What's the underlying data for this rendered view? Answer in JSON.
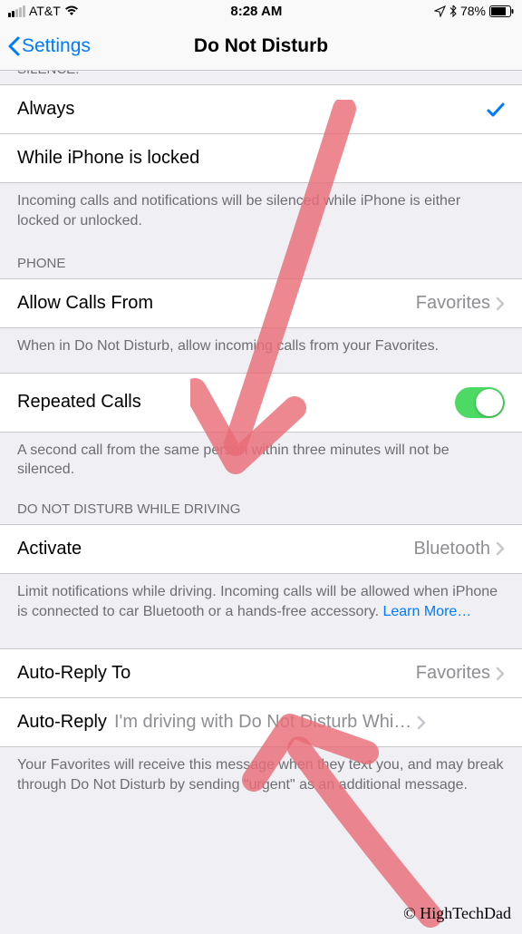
{
  "status_bar": {
    "carrier": "AT&T",
    "time": "8:28 AM",
    "battery_percent": "78%"
  },
  "nav": {
    "back_label": "Settings",
    "title": "Do Not Disturb"
  },
  "silence": {
    "header": "SILENCE:",
    "always_label": "Always",
    "locked_label": "While iPhone is locked",
    "footer": "Incoming calls and notifications will be silenced while iPhone is either locked or unlocked."
  },
  "phone": {
    "header": "PHONE",
    "allow_calls_label": "Allow Calls From",
    "allow_calls_value": "Favorites",
    "allow_calls_footer": "When in Do Not Disturb, allow incoming calls from your Favorites.",
    "repeated_calls_label": "Repeated Calls",
    "repeated_calls_footer": "A second call from the same person within three minutes will not be silenced."
  },
  "driving": {
    "header": "DO NOT DISTURB WHILE DRIVING",
    "activate_label": "Activate",
    "activate_value": "Bluetooth",
    "activate_footer": "Limit notifications while driving. Incoming calls will be allowed when iPhone is connected to car Bluetooth or a hands-free accessory. ",
    "learn_more": "Learn More…",
    "auto_reply_to_label": "Auto-Reply To",
    "auto_reply_to_value": "Favorites",
    "auto_reply_label": "Auto-Reply",
    "auto_reply_value": "I'm driving with Do Not Disturb Whi…",
    "auto_reply_footer": "Your Favorites will receive this message when they text you, and may break through Do Not Disturb by sending \"urgent\" as an additional message."
  },
  "copyright": "© HighTechDad",
  "colors": {
    "accent": "#007aff",
    "toggle_on": "#4cd964",
    "arrow": "#e96d77"
  }
}
